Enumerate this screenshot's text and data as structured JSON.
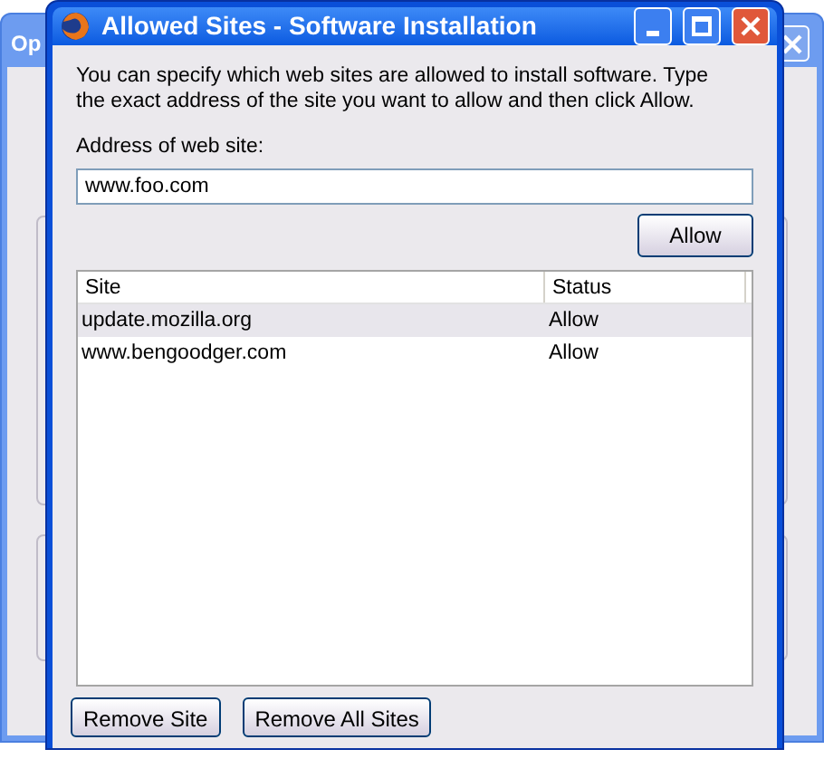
{
  "background_window": {
    "title": "Op"
  },
  "dialog": {
    "title": "Allowed Sites - Software Installation",
    "description": "You can specify which web sites are allowed to install software. Type the exact address of the site you want to allow and then click Allow.",
    "address_label": "Address of web site:",
    "address_value": "www.foo.com",
    "allow_button": "Allow",
    "table": {
      "columns": [
        "Site",
        "Status"
      ],
      "rows": [
        {
          "site": "update.mozilla.org",
          "status": "Allow",
          "selected": true
        },
        {
          "site": "www.bengoodger.com",
          "status": "Allow",
          "selected": false
        }
      ]
    },
    "buttons": [
      "Remove Site",
      "Remove All Sites"
    ]
  }
}
